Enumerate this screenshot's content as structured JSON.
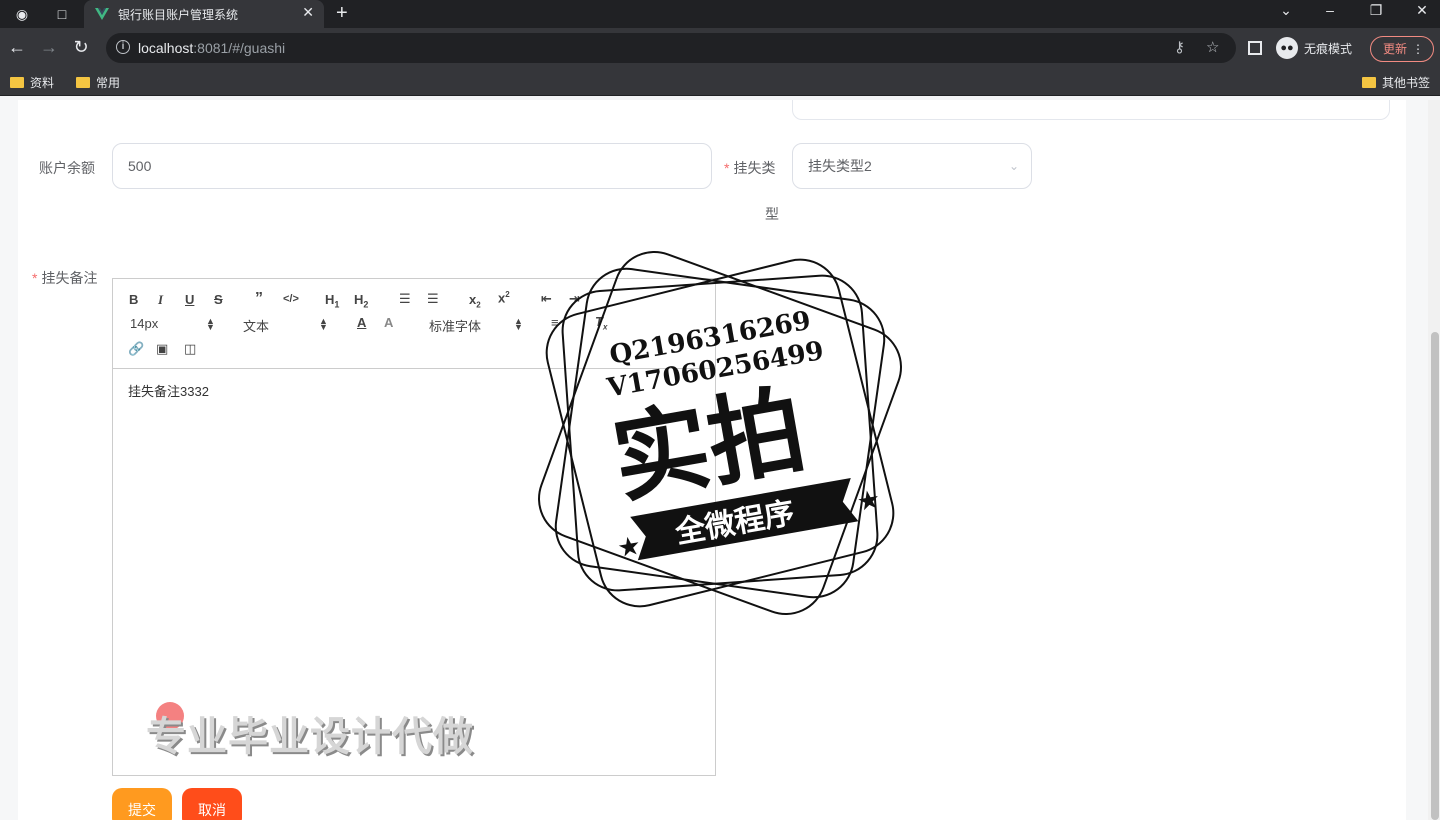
{
  "browser": {
    "tab_title": "银行账目账户管理系统",
    "url_host": "localhost",
    "url_rest": ":8081/#/guashi",
    "incognito_label": "无痕模式",
    "update_label": "更新",
    "bookmarks": [
      "资料",
      "常用"
    ],
    "other_bookmarks": "其他书签"
  },
  "form": {
    "balance_label": "账户余额",
    "balance_value": "500",
    "loss_type_label_line1": "挂失类",
    "loss_type_label_line2": "型",
    "loss_type_value": "挂失类型2",
    "remark_label": "挂失备注",
    "remark_value": "挂失备注3332",
    "submit_label": "提交",
    "cancel_label": "取消"
  },
  "editor_toolbar": {
    "font_size": "14px",
    "paragraph": "文本",
    "font_family": "标准字体"
  },
  "overlay": {
    "stamp_line1": "Q2196316269",
    "stamp_line2": "V17060256499",
    "stamp_big": "实拍",
    "stamp_banner": "全微程序",
    "watermark": "专业毕业设计代做"
  }
}
